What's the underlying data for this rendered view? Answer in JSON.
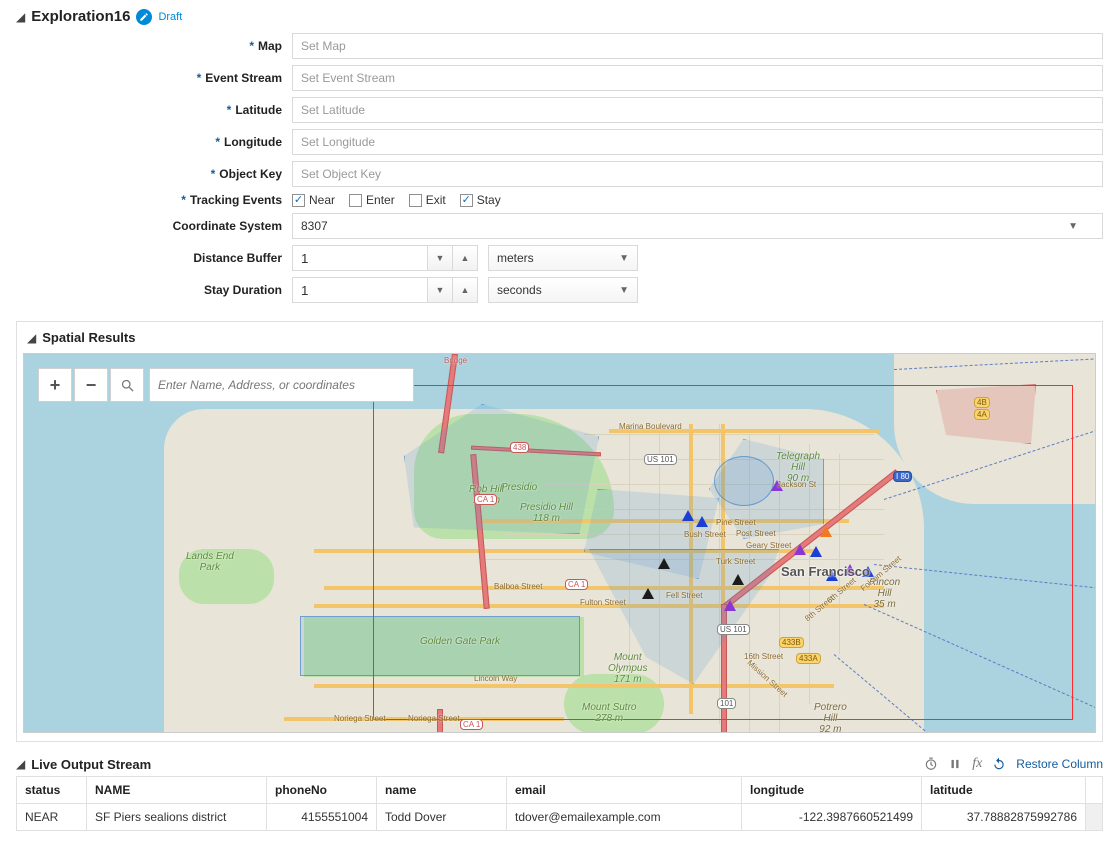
{
  "header": {
    "title": "Exploration16",
    "status": "Draft"
  },
  "form": {
    "map": {
      "label": "Map",
      "placeholder": "Set Map"
    },
    "eventStream": {
      "label": "Event Stream",
      "placeholder": "Set Event Stream"
    },
    "latitude": {
      "label": "Latitude",
      "placeholder": "Set Latitude"
    },
    "longitude": {
      "label": "Longitude",
      "placeholder": "Set Longitude"
    },
    "objectKey": {
      "label": "Object Key",
      "placeholder": "Set Object Key"
    },
    "trackingEvents": {
      "label": "Tracking Events",
      "options": {
        "near": {
          "label": "Near",
          "checked": true
        },
        "enter": {
          "label": "Enter",
          "checked": false
        },
        "exit": {
          "label": "Exit",
          "checked": false
        },
        "stay": {
          "label": "Stay",
          "checked": true
        }
      }
    },
    "coordinateSystem": {
      "label": "Coordinate System",
      "value": "8307"
    },
    "distanceBuffer": {
      "label": "Distance Buffer",
      "value": "1",
      "unit": "meters"
    },
    "stayDuration": {
      "label": "Stay Duration",
      "value": "1",
      "unit": "seconds"
    }
  },
  "spatialResults": {
    "title": "Spatial Results",
    "searchPlaceholder": "Enter Name, Address, or coordinates",
    "cityLabel": "San Francisco",
    "parks": {
      "ggp": "Golden Gate Park",
      "presidio": "Presidio",
      "robHill": "Rob Hill\n117 m",
      "presidioHill": "Presidio Hill\n118 m",
      "landsEnd": "Lands End\nPark",
      "mtSutro": "Mount Sutro\n278 m",
      "mtOlympus": "Mount\nOlympus\n171 m",
      "telegraph": "Telegraph\nHill\n90 m",
      "rincon": "Rincon\nHill\n35 m",
      "potrero": "Potrero\nHill\n92 m"
    },
    "roads": {
      "fell": "Fell Street",
      "turk": "Turk Street",
      "bush": "Bush Street",
      "geary": "Geary Street",
      "post": "Post Street",
      "pine": "Pine Street",
      "jackson": "Jackson St",
      "marina": "Marina Boulevard",
      "balboa": "Balboa Street",
      "fulton": "Fulton Street",
      "lincoln": "Lincoln Way",
      "noriega": "Noriega Street",
      "sixteenth": "16th Street",
      "eighth": "8th Street",
      "sixth": "6th Street",
      "folsom": "Folsom Street",
      "mission": "Mission Street"
    },
    "shields": {
      "ca1a": "CA 1",
      "ca1b": "CA 1",
      "ca1c": "CA 1",
      "us101a": "US 101",
      "us101b": "US 101",
      "us101c": "101",
      "i80": "I 80",
      "b433": "433B",
      "a433": "433A",
      "fourB": "4B",
      "fourA": "4A",
      "bridge": "Bridge",
      "c438": "438"
    }
  },
  "liveOutput": {
    "title": "Live Output Stream",
    "restoreLabel": "Restore Column",
    "columns": [
      "status",
      "NAME",
      "phoneNo",
      "name",
      "email",
      "longitude",
      "latitude"
    ],
    "rows": [
      {
        "status": "NEAR",
        "NAME": "SF Piers sealions district",
        "phoneNo": "4155551004",
        "name": "Todd Dover",
        "email": "tdover@emailexample.com",
        "longitude": "-122.3987660521499",
        "latitude": "37.78882875992786"
      }
    ]
  }
}
